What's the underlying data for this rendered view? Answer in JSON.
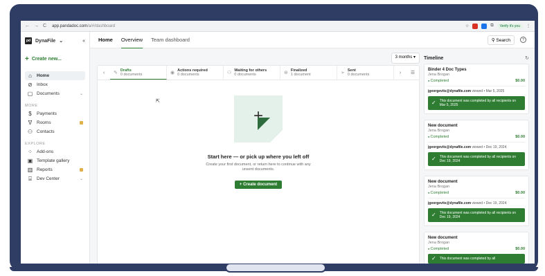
{
  "browser": {
    "nav": [
      "←",
      "→",
      "C"
    ],
    "url_domain": "app.pandadoc.com",
    "url_path": "/a/#/dashboard",
    "verify_label": "Verify it's you"
  },
  "sidebar": {
    "brand": "DynaFile",
    "brand_logo": "pd",
    "create_label": "Create new...",
    "main_items": [
      {
        "label": "Home",
        "icon": "home-icon"
      },
      {
        "label": "Inbox",
        "icon": "inbox-icon"
      },
      {
        "label": "Documents",
        "icon": "document-icon"
      }
    ],
    "more_label": "MORE",
    "more_items": [
      {
        "label": "Payments",
        "icon": "dollar-icon"
      },
      {
        "label": "Rooms",
        "icon": "rooms-icon"
      },
      {
        "label": "Contacts",
        "icon": "contacts-icon"
      }
    ],
    "explore_label": "EXPLORE",
    "explore_items": [
      {
        "label": "Add-ons",
        "icon": "addons-icon"
      },
      {
        "label": "Template gallery",
        "icon": "template-icon"
      },
      {
        "label": "Reports",
        "icon": "reports-icon"
      },
      {
        "label": "Dev Center",
        "icon": "dev-icon"
      }
    ]
  },
  "topnav": {
    "home": "Home",
    "overview": "Overview",
    "team": "Team dashboard",
    "search": "Search"
  },
  "range": "3 months",
  "statuses": [
    {
      "title": "Drafts",
      "count": "0 documents"
    },
    {
      "title": "Actions required",
      "count": "0 documents"
    },
    {
      "title": "Waiting for others",
      "count": "0 documents"
    },
    {
      "title": "Finalized",
      "count": "1 document"
    },
    {
      "title": "Sent",
      "count": "0 documents"
    }
  ],
  "empty": {
    "title": "Start here — or pick up where you left off",
    "subtitle": "Create your first document, or return here to continue with any unsent documents.",
    "button": "+ Create document"
  },
  "timeline": {
    "title": "Timeline",
    "cards": [
      {
        "title": "Binder 4 Doc Types",
        "owner": "Jena Brogan",
        "status": "Completed",
        "amount": "$0.00",
        "viewer": "jgeorgevits@dynafile.com",
        "viewed": " viewed • Mar 5, 2025",
        "complete": "This document was completed by all recipients on Mar 5, 2025"
      },
      {
        "title": "New document",
        "owner": "Jena Brogan",
        "status": "Completed",
        "amount": "$0.00",
        "viewer": "jgeorgevits@dynafile.com",
        "viewed": " viewed • Dec 19, 2024",
        "complete": "This document was completed by all recipients on Dec 19, 2024"
      },
      {
        "title": "New document",
        "owner": "Jena Brogan",
        "status": "Completed",
        "amount": "$0.00",
        "viewer": "jgeorgevits@dynafile.com",
        "viewed": " viewed • Dec 19, 2024",
        "complete": "This document was completed by all recipients on Dec 19, 2024"
      },
      {
        "title": "New document",
        "owner": "Jena Brogan",
        "status": "Completed",
        "amount": "$0.00",
        "viewer": "",
        "viewed": "",
        "complete": "This document was completed by all"
      }
    ]
  }
}
